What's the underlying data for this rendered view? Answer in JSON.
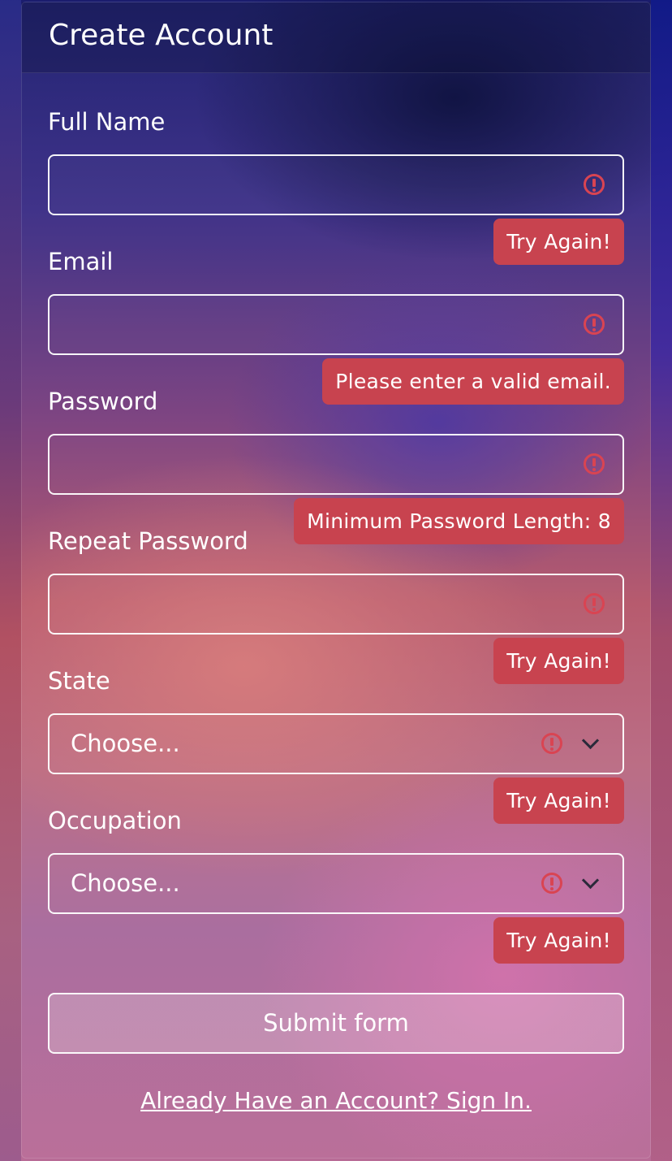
{
  "form": {
    "title": "Create Account",
    "fields": [
      {
        "label": "Full Name",
        "value": "",
        "error": "Try Again!"
      },
      {
        "label": "Email",
        "value": "",
        "error": "Please enter a valid email."
      },
      {
        "label": "Password",
        "value": "",
        "error": "Minimum Password Length: 8"
      },
      {
        "label": "Repeat Password",
        "value": "",
        "error": "Try Again!"
      }
    ],
    "selects": [
      {
        "label": "State",
        "selected": "Choose...",
        "error": "Try Again!"
      },
      {
        "label": "Occupation",
        "selected": "Choose...",
        "error": "Try Again!"
      }
    ],
    "submit_label": "Submit form",
    "signin_link": "Already Have an Account? Sign In."
  },
  "colors": {
    "error": "#c8434f",
    "error_icon": "#d94452",
    "text": "#ffffff"
  },
  "icons": {
    "error": "exclamation-circle-icon",
    "dropdown": "chevron-down-icon"
  }
}
